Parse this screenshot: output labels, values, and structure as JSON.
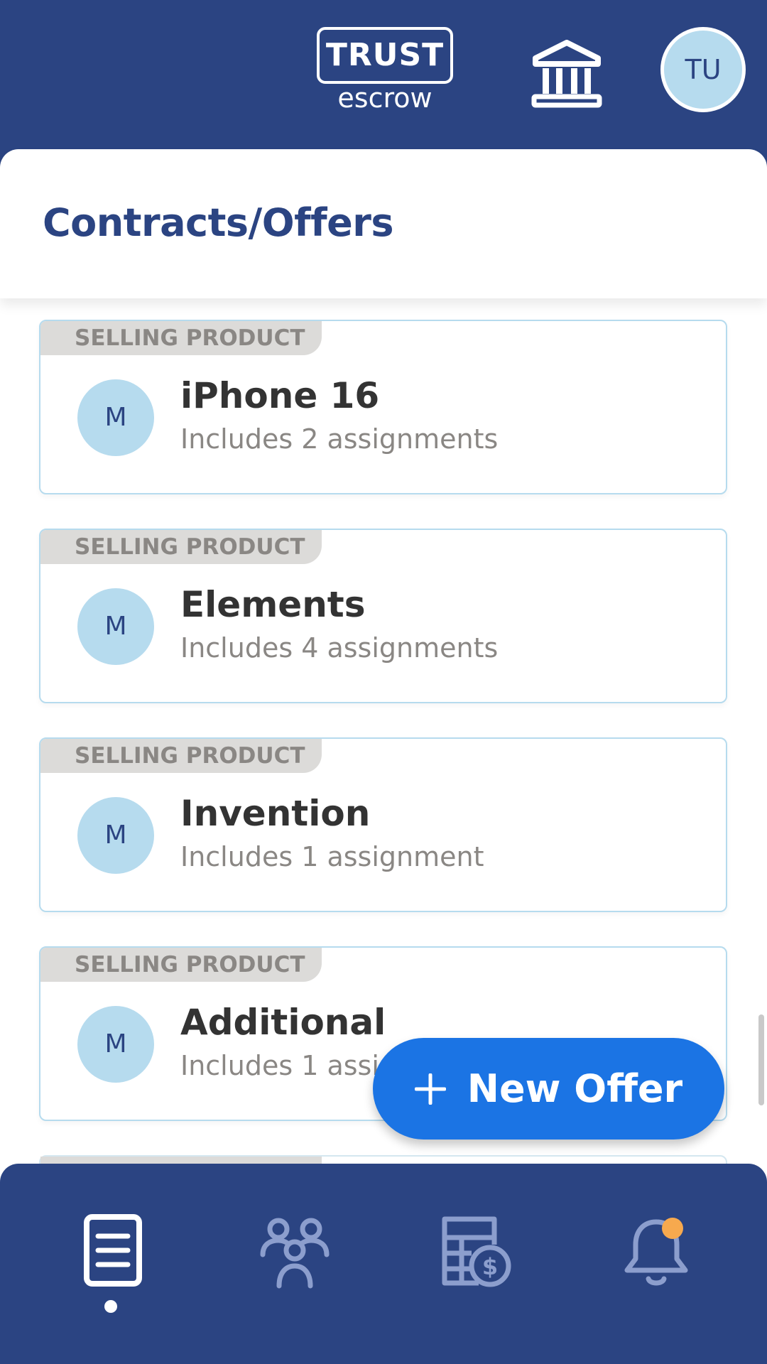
{
  "header": {
    "logo_main": "TRUST",
    "logo_sub": "escrow",
    "avatar_initials": "TU"
  },
  "page": {
    "title": "Contracts/Offers"
  },
  "contracts": [
    {
      "tag": "SELLING PRODUCT",
      "avatar": "M",
      "title": "iPhone 16",
      "subtitle": "Includes 2 assignments"
    },
    {
      "tag": "SELLING PRODUCT",
      "avatar": "M",
      "title": "Elements",
      "subtitle": "Includes 4 assignments"
    },
    {
      "tag": "SELLING PRODUCT",
      "avatar": "M",
      "title": "Invention",
      "subtitle": "Includes 1 assignment"
    },
    {
      "tag": "SELLING PRODUCT",
      "avatar": "M",
      "title": "Additional",
      "subtitle": "Includes 1 assignment"
    }
  ],
  "fab": {
    "label": "New Offer",
    "icon": "plus-icon"
  },
  "bottom_nav": {
    "items": [
      {
        "icon": "document-list-icon",
        "active": true
      },
      {
        "icon": "users-group-icon",
        "active": false
      },
      {
        "icon": "finance-calculator-icon",
        "active": false
      },
      {
        "icon": "bell-icon",
        "active": false,
        "has_notification": true
      }
    ]
  },
  "colors": {
    "primary": "#2b4482",
    "accent": "#1b74e4",
    "avatar_bg": "#b6dbee",
    "tag_bg": "#dcdbd9",
    "notification": "#f7a94e"
  }
}
